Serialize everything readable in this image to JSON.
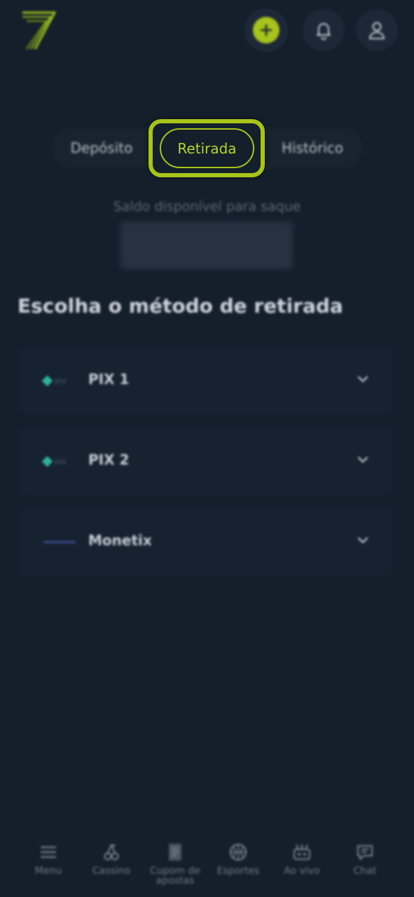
{
  "header": {
    "logo_icon": "seven-logo-icon",
    "deposit_button_icon": "plus-icon",
    "notifications_icon": "bell-icon",
    "profile_icon": "user-icon",
    "accent_color": "#a8c41a"
  },
  "tabs": [
    {
      "label": "Depósito",
      "active": false
    },
    {
      "label": "Retirada",
      "active": true
    },
    {
      "label": "Histórico",
      "active": false
    }
  ],
  "balance": {
    "label": "Saldo disponível para saque"
  },
  "section_title": "Escolha o método de retirada",
  "methods": [
    {
      "name": "PIX 1",
      "logo": "pix-logo",
      "logo_text": "pix",
      "icon": "chevron-down-icon"
    },
    {
      "name": "PIX 2",
      "logo": "pix-logo",
      "logo_text": "pix",
      "icon": "chevron-down-icon"
    },
    {
      "name": "Monetix",
      "logo": "monetix-logo",
      "icon": "chevron-down-icon"
    }
  ],
  "bottom_nav": [
    {
      "label": "Menu",
      "icon": "hamburger-icon"
    },
    {
      "label": "Cassino",
      "icon": "cherries-icon"
    },
    {
      "label": "Cupom de apostas",
      "icon": "ticket-icon"
    },
    {
      "label": "Esportes",
      "icon": "basketball-icon"
    },
    {
      "label": "Ao vivo",
      "icon": "live-icon"
    },
    {
      "label": "Chat",
      "icon": "chat-icon"
    }
  ]
}
